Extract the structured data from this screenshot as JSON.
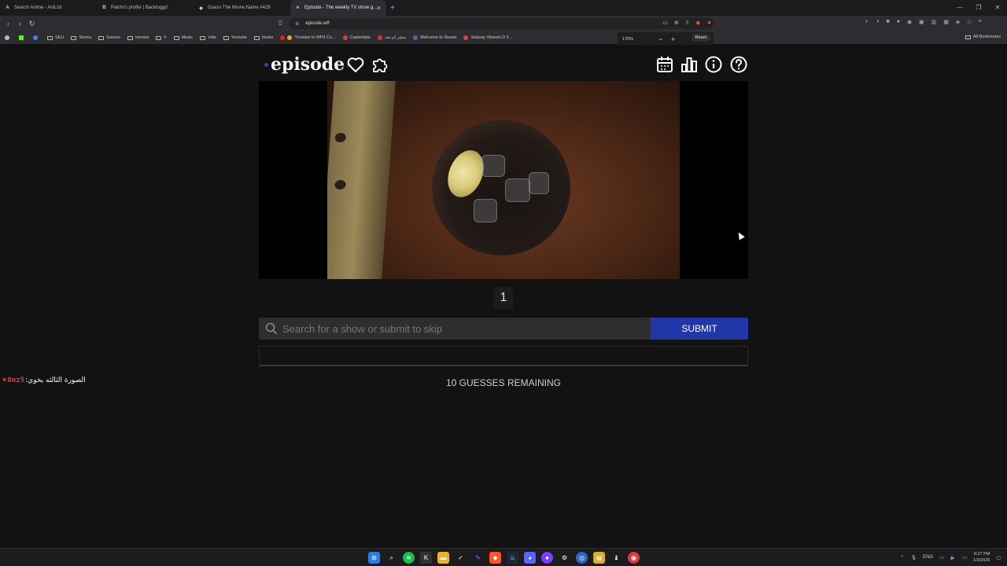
{
  "browser": {
    "tabs": [
      {
        "title": "Search Anime - AniList",
        "fav": "A",
        "active": false
      },
      {
        "title": "Patchi's profile | Backloggd",
        "fav": "B",
        "active": false
      },
      {
        "title": "Guess The Movie.Name #429",
        "fav": "◆",
        "active": false
      },
      {
        "title": "Episode - The weekly TV show g...",
        "fav": "e",
        "active": true
      }
    ],
    "url": "episode.wtf",
    "zoom": {
      "level": "175%",
      "reset_label": "Reset"
    },
    "bookmarks": [
      "SEU",
      "Stores",
      "Games",
      "movies",
      "F",
      "Music",
      "Vids",
      "Youtube",
      "books",
      "Youtube to MP3 Co...",
      "Casterlabs",
      "متجر ام نجد",
      "Welcome to Steam",
      "Solaray Vitamin D 5..."
    ],
    "all_bookmarks_label": "All Bookmarks"
  },
  "page": {
    "logo_text": "episode",
    "round_number": "1",
    "search_placeholder": "Search for a show or submit to skip",
    "submit_label": "SUBMIT",
    "guesses_remaining": "10 GUESSES REMAINING"
  },
  "chat": {
    "username": "0nz5",
    "separator": ":",
    "message": "الصورة الثالثه يخوي"
  },
  "taskbar": {
    "lang": "ENG",
    "time": "9:27 PM",
    "date": "1/3/2026"
  },
  "colors": {
    "accent": "#1f37a8",
    "logo_dot": "#2548c2",
    "background": "#121212"
  }
}
